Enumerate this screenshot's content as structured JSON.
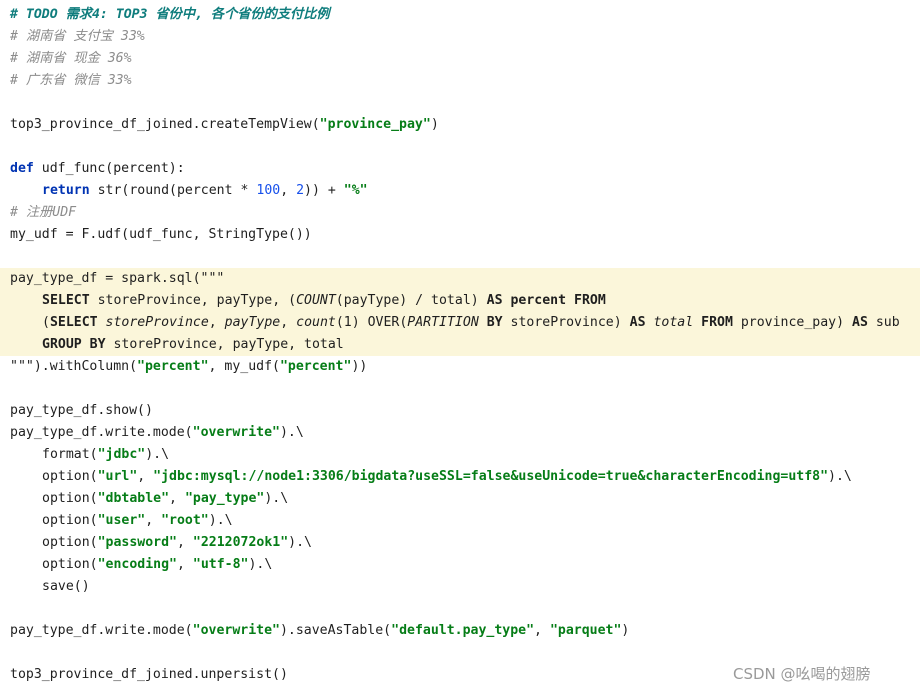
{
  "comments": {
    "todo": "# TODO 需求4: TOP3 省份中, 各个省份的支付比例",
    "example_1": "# 湖南省 支付宝 33%",
    "example_2": "# 湖南省 现金 36%",
    "example_3": "# 广东省 微信 33%",
    "register_udf": "# 注册UDF"
  },
  "create_view": {
    "obj": "top3_province_df_joined.createTempView(",
    "arg": "\"province_pay\"",
    "close": ")"
  },
  "udf_def": {
    "kw_def": "def",
    "sig": " udf_func(percent):",
    "kw_return": "return",
    "expr_a": " str(round(percent * ",
    "num_100": "100",
    "comma": ", ",
    "num_2": "2",
    "expr_b": ")) + ",
    "pct": "\"%\""
  },
  "my_udf_line": "my_udf = F.udf(udf_func, StringType())",
  "sql_block": {
    "open": "pay_type_df = spark.sql(\"\"\"",
    "l1": {
      "select": "SELECT",
      "a": " storeProvince, payType, (",
      "count": "COUNT",
      "b": "(payType) / total) ",
      "as": "AS",
      "percent": " percent ",
      "from": "FROM"
    },
    "l2": {
      "paren": "(",
      "select": "SELECT",
      "sp": " ",
      "storeProvince": "storeProvince",
      "c1": ", ",
      "payType": "payType",
      "c2": ", ",
      "count": "count",
      "args": "(1) OVER(",
      "partition": "PARTITION",
      "by": " BY",
      "sp2": " storeProvince) ",
      "as": "AS",
      "sp3": " ",
      "total": "total",
      "sp4": " ",
      "from": "FROM",
      "tbl": " province_pay) ",
      "as2": "AS",
      "sub": " sub"
    },
    "l3": {
      "group_by": "GROUP BY",
      "rest": " storeProvince, payType, total"
    },
    "close_a": "\"\"\").withColumn(",
    "close_s1": "\"percent\"",
    "close_b": ", my_udf(",
    "close_s2": "\"percent\"",
    "close_c": "))"
  },
  "show_line": "pay_type_df.show()",
  "write_chain": {
    "head_a": "pay_type_df.write.mode(",
    "head_s": "\"overwrite\"",
    "head_b": ").\\",
    "format": {
      "a": "format(",
      "s": "\"jdbc\"",
      "b": ").\\"
    },
    "url": {
      "a": "option(",
      "k": "\"url\"",
      "c": ", ",
      "v": "\"jdbc:mysql://node1:3306/bigdata?useSSL=false&useUnicode=true&characterEncoding=utf8\"",
      "b": ").\\"
    },
    "dbtable": {
      "a": "option(",
      "k": "\"dbtable\"",
      "c": ", ",
      "v": "\"pay_type\"",
      "b": ").\\"
    },
    "user": {
      "a": "option(",
      "k": "\"user\"",
      "c": ", ",
      "v": "\"root\"",
      "b": ").\\"
    },
    "password": {
      "a": "option(",
      "k": "\"password\"",
      "c": ", ",
      "v": "\"2212072ok1\"",
      "b": ").\\"
    },
    "encoding": {
      "a": "option(",
      "k": "\"encoding\"",
      "c": ", ",
      "v": "\"utf-8\"",
      "b": ").\\"
    },
    "save": "save()"
  },
  "save_table": {
    "a": "pay_type_df.write.mode(",
    "s1": "\"overwrite\"",
    "b": ").saveAsTable(",
    "s2": "\"default.pay_type\"",
    "c": ", ",
    "s3": "\"parquet\"",
    "d": ")"
  },
  "unpersist_line": "top3_province_df_joined.unpersist()",
  "watermark": "CSDN @吆喝的翅膀",
  "colors": {
    "comment": "#8c8c8c",
    "todo": "#0f7d7d",
    "keyword": "#0033b3",
    "string": "#067d17",
    "number": "#1750eb",
    "highlight_band": "#fbf6da"
  }
}
